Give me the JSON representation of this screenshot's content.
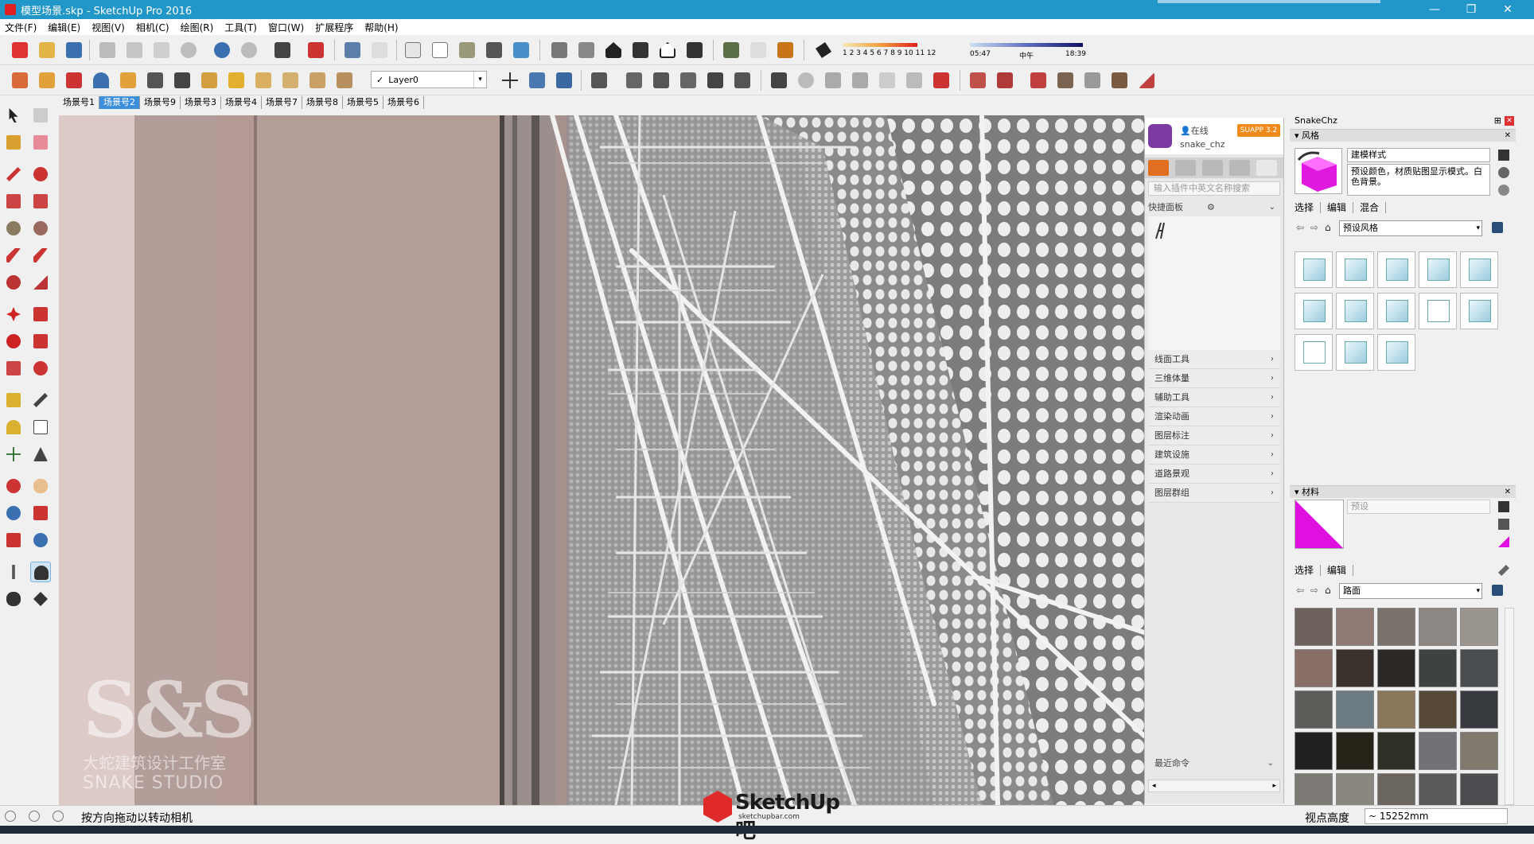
{
  "window": {
    "title": "模型场景.skp - SketchUp Pro 2016",
    "minimize": "—",
    "maximize": "❐",
    "close": "✕"
  },
  "menu": [
    "文件(F)",
    "编辑(E)",
    "视图(V)",
    "相机(C)",
    "绘图(R)",
    "工具(T)",
    "窗口(W)",
    "扩展程序",
    "帮助(H)"
  ],
  "layer": {
    "checkmark": "✓",
    "name": "Layer0",
    "dropdown": "▾"
  },
  "shadow_ruler": {
    "numbers": "1 2 3 4 5 6 7 8 9 10 11 12"
  },
  "time_ruler": {
    "start": "05:47",
    "mid": "中午",
    "end": "18:39"
  },
  "scene_tabs": [
    "场景号1",
    "场景号2",
    "场景号9",
    "场景号3",
    "场景号4",
    "场景号7",
    "场景号8",
    "场景号5",
    "场景号6"
  ],
  "active_scene_index": 1,
  "watermark": {
    "big": "S&S",
    "cn": "大蛇建筑设计工作室",
    "en": "SNAKE STUDIO"
  },
  "plugin": {
    "status": "👤在线",
    "user": "snake_chz",
    "badge": "SUAPP 3.2",
    "search_placeholder": "输入插件中英文名称搜索",
    "quick_label": "快捷面板",
    "quick_gear": "⚙",
    "quick_chevron": "⌄",
    "categories": [
      "线面工具",
      "三维体量",
      "辅助工具",
      "渲染动画",
      "图层标注",
      "建筑设施",
      "道路景观",
      "图层群组"
    ],
    "category_arrow": "›",
    "recent": "最近命令",
    "recent_arrow": "⌄",
    "scroll_left": "◂",
    "scroll_right": "▸"
  },
  "tray": {
    "title": "SnakeChz",
    "pin": "⊞",
    "close": "✕",
    "styles": {
      "header": "▾ 风格",
      "header_close": "✕",
      "name": "建模样式",
      "description": "预设颜色，材质贴图显示模式。白色背景。",
      "tabs": [
        "选择",
        "编辑",
        "混合"
      ],
      "back": "⇦",
      "forward": "⇨",
      "home": "⌂",
      "dropdown_value": "预设风格",
      "dropdown_arrow": "▾"
    },
    "materials": {
      "header": "▾ 材料",
      "header_close": "✕",
      "name_placeholder": "预设",
      "tabs": [
        "选择",
        "编辑"
      ],
      "back": "⇦",
      "forward": "⇨",
      "home": "⌂",
      "dropdown_value": "路面",
      "dropdown_arrow": "▾",
      "swatch_colors": [
        "#6e625c",
        "#8e7a72",
        "#7a716c",
        "#8d8883",
        "#9a968f",
        "#8a6e68",
        "#3a302c",
        "#2c2826",
        "#3d4440",
        "#4a4e50",
        "#5e5c58",
        "#6c7a84",
        "#8a7658",
        "#554836",
        "#363a3e",
        "#202020",
        "#262418",
        "#303028",
        "#707276",
        "#807a6e",
        "#7c7874",
        "#8a8680",
        "#6c6660",
        "#585a5c",
        "#4a4c50"
      ]
    }
  },
  "status": {
    "message": "按方向拖动以转动相机",
    "vcb_label": "视点高度",
    "vcb_value": "~ 15252mm"
  },
  "logo": {
    "name": "SketchUp吧",
    "url": "sketchupbar.com"
  }
}
